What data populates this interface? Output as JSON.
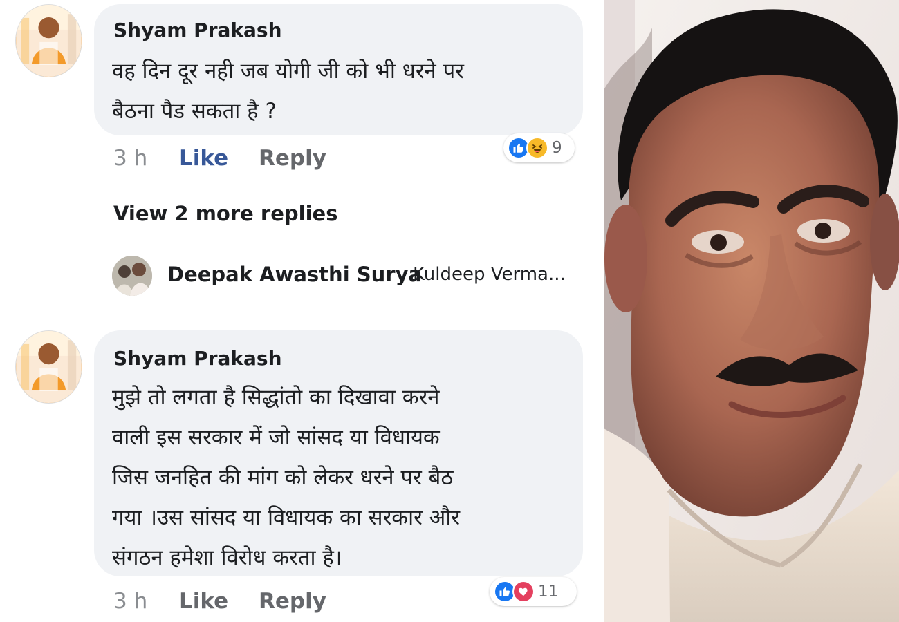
{
  "comments": [
    {
      "author": "Shyam Prakash",
      "text": "वह दिन दूर नही जब योगी जी को भी धरने पर\nबैठना पैड सकता है ?",
      "time": "3 h",
      "like_label": "Like",
      "reply_label": "Reply",
      "reaction_count": "9",
      "reactions": [
        "like-icon",
        "haha-icon"
      ]
    },
    {
      "author": "Shyam Prakash",
      "text": "मुझे तो लगता है सिद्धांतो का दिखावा करने\nवाली इस सरकार में जो सांसद या विधायक\nजिस जनहित की  मांग को लेकर धरने पर बैठ\nगया ।उस सांसद या विधायक का सरकार और\nसंगठन हमेशा विरोध करता है।",
      "time": "3 h",
      "like_label": "Like",
      "reply_label": "Reply",
      "reaction_count": "11",
      "reactions": [
        "like-icon",
        "love-icon"
      ]
    }
  ],
  "replies": {
    "view_more_label": "View 2 more replies",
    "preview_name": "Deepak Awasthi Surya",
    "preview_text": "Kuldeep Verma..."
  },
  "colors": {
    "bubble": "#f0f2f5",
    "like_blue": "#1877f2",
    "link_blue": "#385898",
    "haha_yellow": "#f7b928",
    "love_red": "#e4405f"
  }
}
